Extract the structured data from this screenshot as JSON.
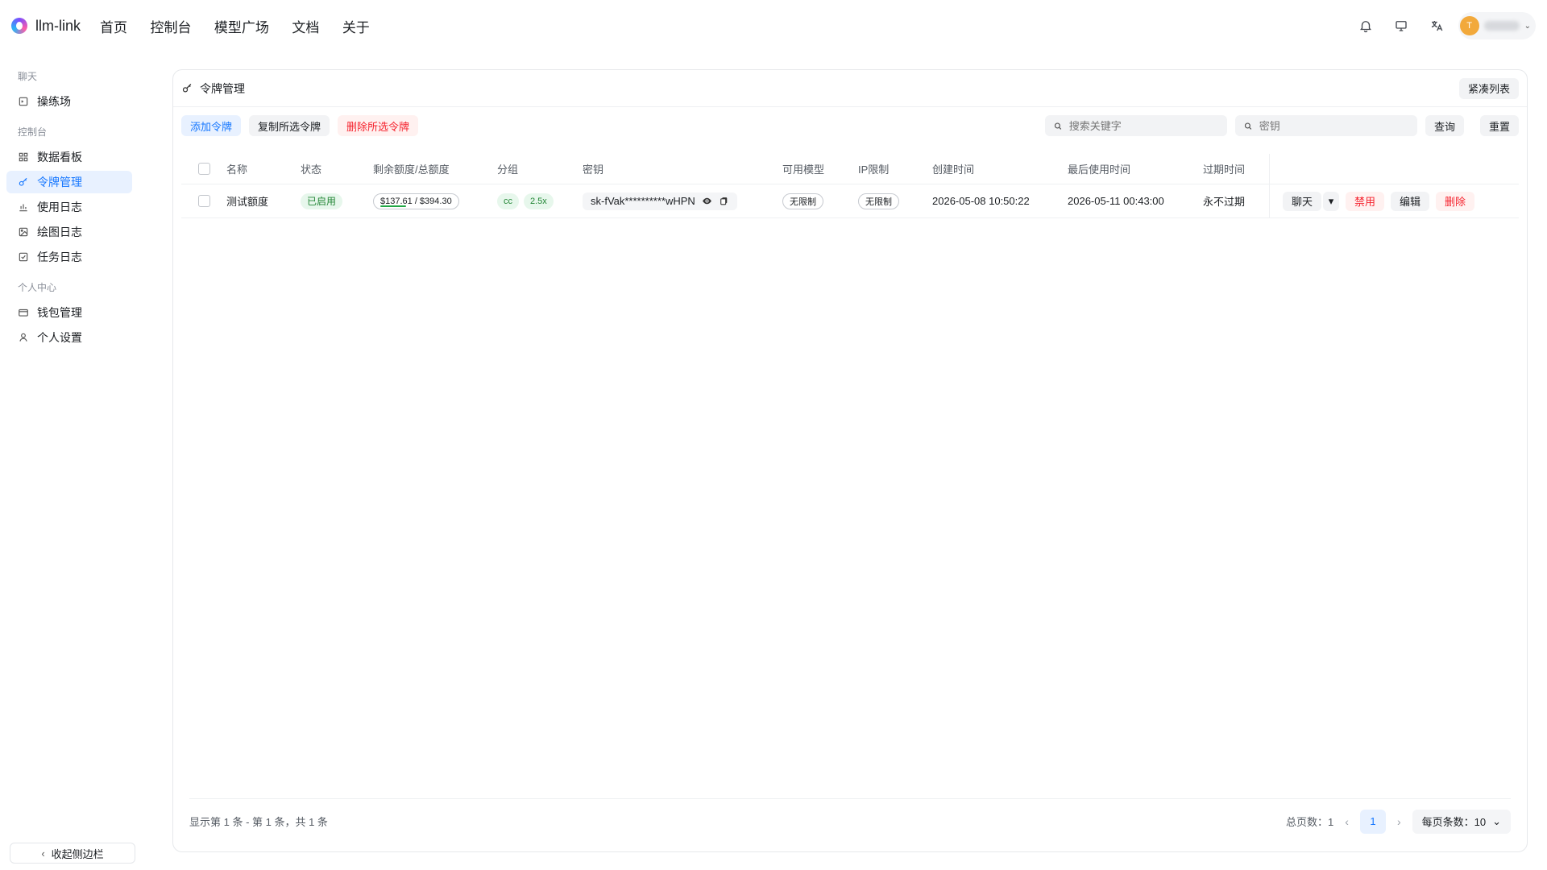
{
  "app": {
    "brand": "llm-link",
    "nav": [
      "首页",
      "控制台",
      "模型广场",
      "文档",
      "关于"
    ],
    "user": {
      "avatar_initial": "T"
    }
  },
  "sidebar": {
    "sections": [
      {
        "title": "聊天",
        "items": [
          {
            "label": "操练场",
            "icon": "playground-icon"
          }
        ]
      },
      {
        "title": "控制台",
        "items": [
          {
            "label": "数据看板",
            "icon": "dashboard-icon"
          },
          {
            "label": "令牌管理",
            "icon": "key-icon",
            "active": true
          },
          {
            "label": "使用日志",
            "icon": "chart-icon"
          },
          {
            "label": "绘图日志",
            "icon": "image-icon"
          },
          {
            "label": "任务日志",
            "icon": "check-square-icon"
          }
        ]
      },
      {
        "title": "个人中心",
        "items": [
          {
            "label": "钱包管理",
            "icon": "wallet-icon"
          },
          {
            "label": "个人设置",
            "icon": "user-icon"
          }
        ]
      }
    ],
    "collapse_label": "收起侧边栏"
  },
  "card": {
    "title": "令牌管理",
    "compact_label": "紧凑列表",
    "toolbar": {
      "add": "添加令牌",
      "copy": "复制所选令牌",
      "delete": "删除所选令牌",
      "search_placeholder": "搜索关键字",
      "key_placeholder": "密钥",
      "query": "查询",
      "reset": "重置"
    },
    "table": {
      "headers": [
        "名称",
        "状态",
        "剩余额度/总额度",
        "分组",
        "密钥",
        "可用模型",
        "IP限制",
        "创建时间",
        "最后使用时间",
        "过期时间"
      ],
      "rows": [
        {
          "name": "测试额度",
          "status": "已启用",
          "quota": "$137.61 / $394.30",
          "quota_remaining_fraction": 0.349,
          "group": "cc",
          "ratio": "2.5x",
          "key": "sk-fVak**********wHPN",
          "models": "无限制",
          "ip": "无限制",
          "created": "2026-05-08 10:50:22",
          "last_used": "2026-05-11 00:43:00",
          "expires": "永不过期",
          "actions": {
            "chat": "聊天",
            "disable": "禁用",
            "edit": "编辑",
            "delete": "删除"
          }
        }
      ]
    },
    "footer": {
      "summary": "显示第 1 条 - 第 1 条，共 1 条",
      "total_pages_label": "总页数：1",
      "current_page": "1",
      "page_size_label": "每页条数：10"
    }
  },
  "colors": {
    "accent": "#1677ff",
    "danger": "#f5222d",
    "success": "#238636"
  }
}
